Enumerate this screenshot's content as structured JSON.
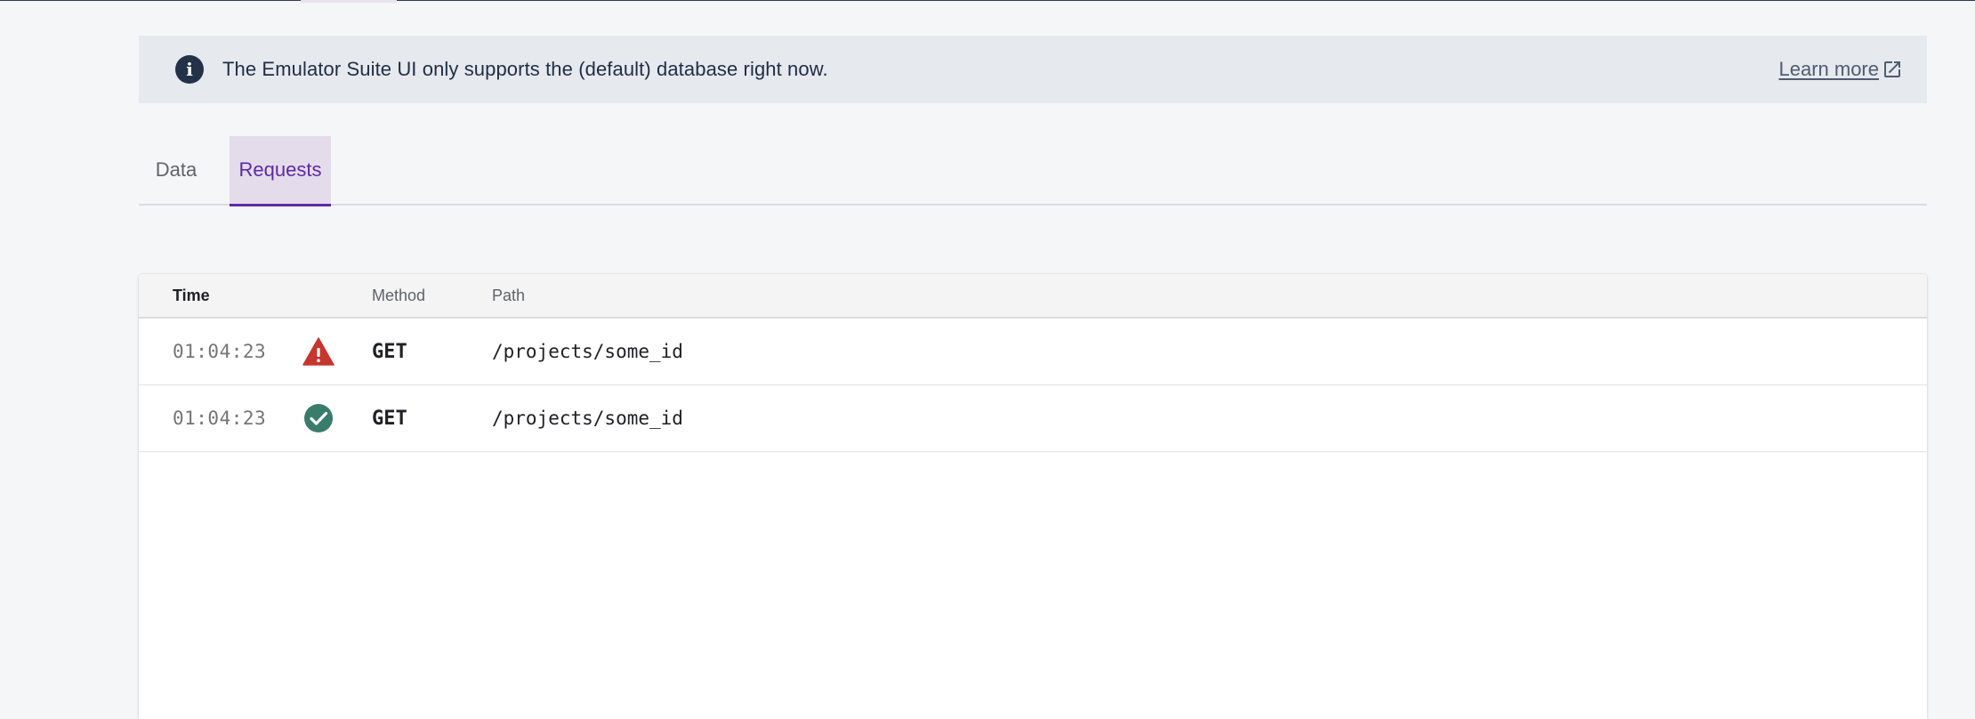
{
  "banner": {
    "icon": "info-icon",
    "icon_glyph": "i",
    "message": "The Emulator Suite UI only supports the (default) database right now.",
    "learn_more_label": "Learn more",
    "learn_more_icon": "external-link-icon"
  },
  "tabs": [
    {
      "label": "Data",
      "active": false
    },
    {
      "label": "Requests",
      "active": true
    }
  ],
  "table": {
    "columns": {
      "time": "Time",
      "status": "",
      "method": "Method",
      "path": "Path"
    },
    "rows": [
      {
        "time": "01:04:23",
        "status": "error",
        "status_icon": "warning-icon",
        "method": "GET",
        "path": "/projects/some_id"
      },
      {
        "time": "01:04:23",
        "status": "success",
        "status_icon": "check-circle-icon",
        "method": "GET",
        "path": "/projects/some_id"
      }
    ]
  },
  "colors": {
    "accent": "#5e2aa3",
    "banner_bg": "#e6e9ee",
    "error": "#c5362e",
    "success": "#3a7c6c"
  }
}
